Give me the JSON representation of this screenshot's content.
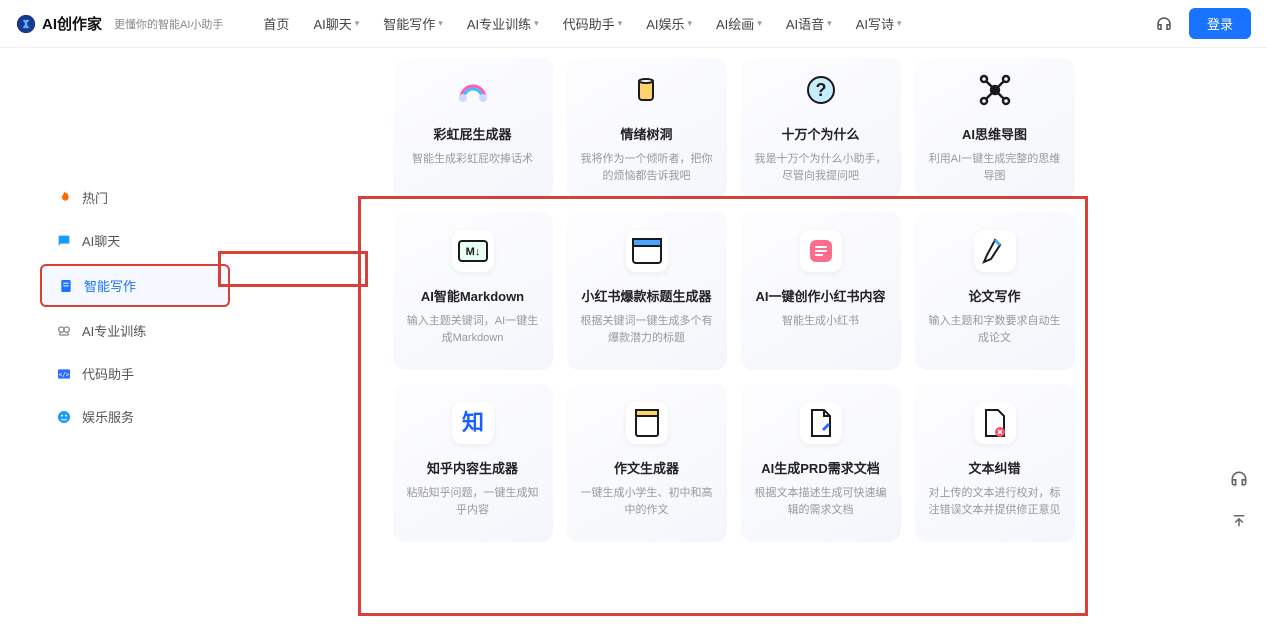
{
  "brand": {
    "name": "AI创作家",
    "tagline": "更懂你的智能AI小助手"
  },
  "nav": {
    "items": [
      {
        "label": "首页",
        "dd": false
      },
      {
        "label": "AI聊天",
        "dd": true
      },
      {
        "label": "智能写作",
        "dd": true
      },
      {
        "label": "AI专业训练",
        "dd": true
      },
      {
        "label": "代码助手",
        "dd": true
      },
      {
        "label": "AI娱乐",
        "dd": true
      },
      {
        "label": "AI绘画",
        "dd": true
      },
      {
        "label": "AI语音",
        "dd": true
      },
      {
        "label": "AI写诗",
        "dd": true
      }
    ],
    "login": "登录"
  },
  "sidebar": {
    "items": [
      {
        "label": "热门",
        "icon": "fire",
        "color": "#ff6a00"
      },
      {
        "label": "AI聊天",
        "icon": "chat",
        "color": "#1a9bff"
      },
      {
        "label": "智能写作",
        "icon": "doc",
        "color": "#1a73ff",
        "active": true
      },
      {
        "label": "AI专业训练",
        "icon": "brain",
        "color": "#888"
      },
      {
        "label": "代码助手",
        "icon": "code",
        "color": "#2e6cff"
      },
      {
        "label": "娱乐服务",
        "icon": "fun",
        "color": "#1a9bff"
      }
    ]
  },
  "cards_top": [
    {
      "title": "彩虹屁生成器",
      "desc": "智能生成彩虹屁吹捧话术",
      "icon": "rainbow"
    },
    {
      "title": "情绪树洞",
      "desc": "我将作为一个倾听者，把你的烦恼都告诉我吧",
      "icon": "cup"
    },
    {
      "title": "十万个为什么",
      "desc": "我是十万个为什么小助手，尽管向我提问吧",
      "icon": "question"
    },
    {
      "title": "AI思维导图",
      "desc": "利用AI一键生成完整的思维导图",
      "icon": "mindmap"
    }
  ],
  "cards_mid": [
    {
      "title": "AI智能Markdown",
      "desc": "输入主题关键词，AI一键生成Markdown",
      "icon": "md"
    },
    {
      "title": "小红书爆款标题生成器",
      "desc": "根据关键词一键生成多个有爆款潜力的标题",
      "icon": "browser"
    },
    {
      "title": "AI一键创作小红书内容",
      "desc": "智能生成小红书",
      "icon": "note"
    },
    {
      "title": "论文写作",
      "desc": "输入主题和字数要求自动生成论文",
      "icon": "pen"
    }
  ],
  "cards_bot": [
    {
      "title": "知乎内容生成器",
      "desc": "粘贴知乎问题，一键生成知乎内容",
      "icon": "zhi"
    },
    {
      "title": "作文生成器",
      "desc": "一键生成小学生、初中和高中的作文",
      "icon": "essay"
    },
    {
      "title": "AI生成PRD需求文档",
      "desc": "根据文本描述生成可快速编辑的需求文档",
      "icon": "prd"
    },
    {
      "title": "文本纠错",
      "desc": "对上传的文本进行校对，标注错误文本并提供修正意见",
      "icon": "error"
    }
  ]
}
